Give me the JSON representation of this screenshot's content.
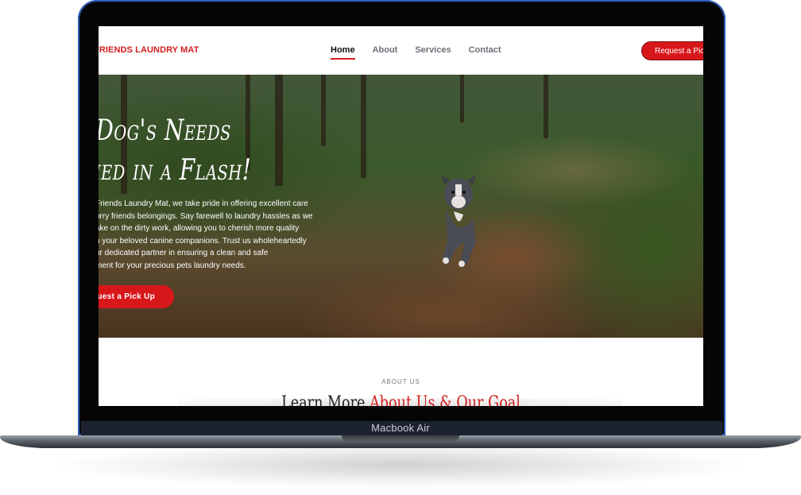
{
  "device": {
    "label": "Macbook Air"
  },
  "nav": {
    "brand": "FRIENDS LAUNDRY MAT",
    "items": [
      {
        "label": "Home",
        "active": true
      },
      {
        "label": "About",
        "active": false
      },
      {
        "label": "Services",
        "active": false
      },
      {
        "label": "Contact",
        "active": false
      }
    ],
    "cta": "Request a Pick"
  },
  "hero": {
    "title_line1": "r Dog's Needs",
    "title_line2": "shed in a Flash!",
    "text_lines": [
      "Friends Laundry Mat, we take pride in offering excellent care",
      "urry friends belongings. Say farewell to laundry hassles as we",
      "ake on the dirty work, allowing you to cherish more quality",
      "h your beloved canine companions. Trust us wholeheartedly",
      "ur dedicated partner in ensuring a clean and safe",
      "ment for your precious pets laundry needs."
    ],
    "cta": "quest a Pick Up"
  },
  "about": {
    "eyebrow": "ABOUT US",
    "title_plain": "Learn More ",
    "title_accent": "About Us & Our Goal"
  },
  "colors": {
    "accent": "#d8171b",
    "brand": "#d21d1d"
  }
}
